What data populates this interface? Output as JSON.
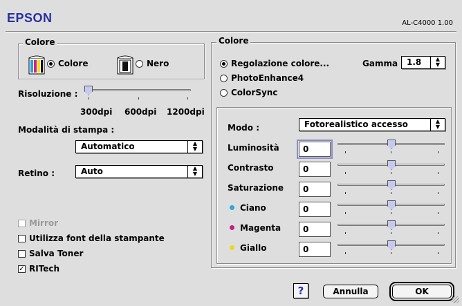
{
  "header": {
    "brand": "EPSON",
    "model": "AL-C4000  1.00"
  },
  "left_color_group": {
    "title": "Colore",
    "options": [
      {
        "label": "Colore",
        "selected": true,
        "icon": "color-cartridge-icon"
      },
      {
        "label": "Nero",
        "selected": false,
        "icon": "black-cartridge-icon"
      }
    ]
  },
  "resolution": {
    "label": "Risoluzione :",
    "marks": [
      "300dpi",
      "600dpi",
      "1200dpi"
    ],
    "selected": "300dpi"
  },
  "print_mode": {
    "label": "Modalità di stampa :",
    "value": "Automatico"
  },
  "screen": {
    "label": "Retino :",
    "value": "Auto"
  },
  "checkboxes": [
    {
      "label": "Mirror",
      "checked": false,
      "disabled": true
    },
    {
      "label": "Utilizza font della stampante",
      "checked": false,
      "disabled": false
    },
    {
      "label": "Salva Toner",
      "checked": false,
      "disabled": false
    },
    {
      "label": "RITech",
      "checked": true,
      "disabled": false
    }
  ],
  "right_color_group": {
    "title": "Colore",
    "options": [
      {
        "label": "Regolazione colore...",
        "selected": true
      },
      {
        "label": "PhotoEnhance4",
        "selected": false
      },
      {
        "label": "ColorSync",
        "selected": false
      }
    ],
    "gamma": {
      "label": "Gamma",
      "value": "1.8"
    }
  },
  "adjust": {
    "mode_label": "Modo :",
    "mode_value": "Fotorealistico accesso",
    "rows": [
      {
        "label": "Luminosità",
        "value": "0",
        "dot_color": null,
        "slider_level": 0.5
      },
      {
        "label": "Contrasto",
        "value": "0",
        "dot_color": null,
        "slider_level": 0.5
      },
      {
        "label": "Saturazione",
        "value": "0",
        "dot_color": null,
        "slider_level": 0.5
      },
      {
        "label": "Ciano",
        "value": "0",
        "dot_color": "#2aa8e0",
        "slider_level": 0.5
      },
      {
        "label": "Magenta",
        "value": "0",
        "dot_color": "#c0208a",
        "slider_level": 0.5
      },
      {
        "label": "Giallo",
        "value": "0",
        "dot_color": "#e8d820",
        "slider_level": 0.5
      }
    ]
  },
  "footer": {
    "help": "?",
    "cancel": "Annulla",
    "ok": "OK"
  },
  "colors": {
    "brand": "#2a2f9e",
    "slider_thumb": "#c8c8ee"
  }
}
